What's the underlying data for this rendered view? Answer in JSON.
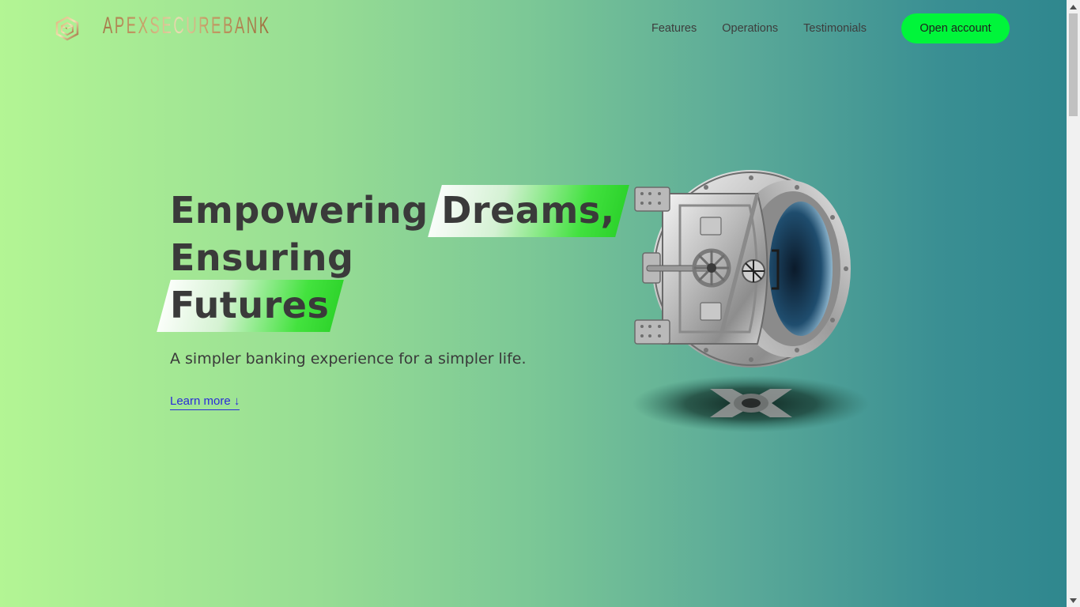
{
  "nav": {
    "logo_text": "APEXSECUREBANK",
    "links": [
      "Features",
      "Operations",
      "Testimonials"
    ],
    "cta_label": "Open account"
  },
  "hero": {
    "title_lines": [
      {
        "plain": "Empowering ",
        "highlight": "Dreams,"
      },
      {
        "plain": "Ensuring",
        "highlight": ""
      },
      {
        "plain": "",
        "highlight": "Futures"
      }
    ],
    "subtitle": "A simpler banking experience for a simpler life.",
    "learn_more": "Learn more ↓"
  },
  "icons": [
    "logo-cube-icon",
    "bank-vault-icon",
    "scroll-up-icon",
    "scroll-down-icon"
  ],
  "colors": {
    "cta": "#00f53a",
    "link": "#2a2ad8",
    "text": "#3a3a3a",
    "gradient_start": "#b3f594",
    "gradient_end": "#2f878e"
  }
}
